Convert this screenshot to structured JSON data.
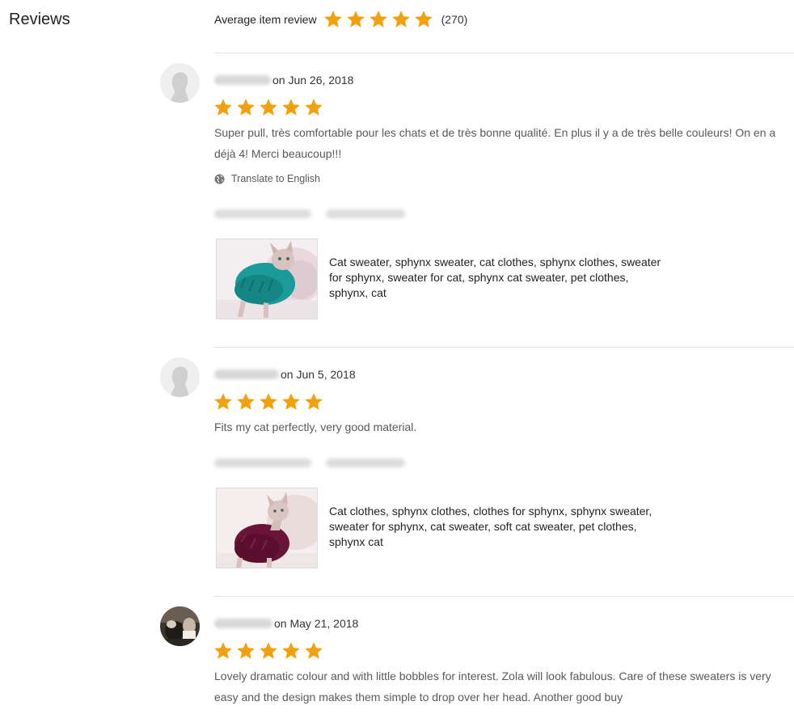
{
  "reviews_section": {
    "title": "Reviews",
    "average_label": "Average item review",
    "average_rating": 5,
    "review_count": "(270)"
  },
  "colors": {
    "star": "#f1a10d",
    "divider": "#e1e3df",
    "body_text": "#595959"
  },
  "reviews": [
    {
      "date": "on Jun 26, 2018",
      "rating": 5,
      "text": "Super pull, très comfortable pour les chats et de très bonne qualité. En plus il y a de très belle couleurs! On en a déjà 4! Merci beaucoup!!!",
      "translate_label": "Translate to English",
      "listing_title": "Cat sweater, sphynx sweater, cat clothes, sphynx clothes, sweater for sphynx, sweater for cat, sphynx cat sweater, pet clothes, sphynx, cat",
      "avatar": "default-avatar-icon"
    },
    {
      "date": "on Jun 5, 2018",
      "rating": 5,
      "text": "Fits my cat perfectly, very good material.",
      "listing_title": "Cat clothes, sphynx clothes, clothes for sphynx, sphynx sweater, sweater for sphynx, cat sweater, soft cat sweater, pet clothes, sphynx cat",
      "avatar": "default-avatar-icon"
    },
    {
      "date": "on May 21, 2018",
      "rating": 5,
      "text": "Lovely dramatic colour and with little bobbles for interest. Zola will look fabulous. Care of these sweaters is very easy and the design makes them simple to drop over her head. Another good buy",
      "avatar": "user-photo-avatar"
    }
  ]
}
